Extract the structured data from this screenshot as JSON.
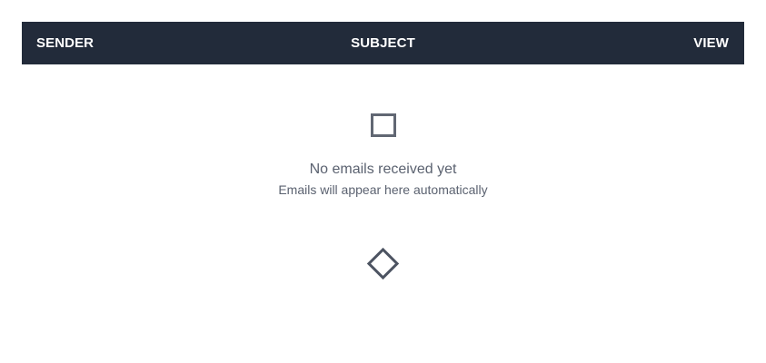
{
  "table": {
    "columns": {
      "sender": "SENDER",
      "subject": "SUBJECT",
      "view": "VIEW"
    }
  },
  "empty_state": {
    "icon": "mail-icon",
    "title": "No emails received yet",
    "subtitle": "Emails will appear here automatically",
    "loader_icon": "diamond-loader-icon"
  },
  "colors": {
    "header_bg": "#222b3a",
    "header_text": "#ffffff",
    "muted_text": "#5b6270",
    "icon": "#616773"
  }
}
